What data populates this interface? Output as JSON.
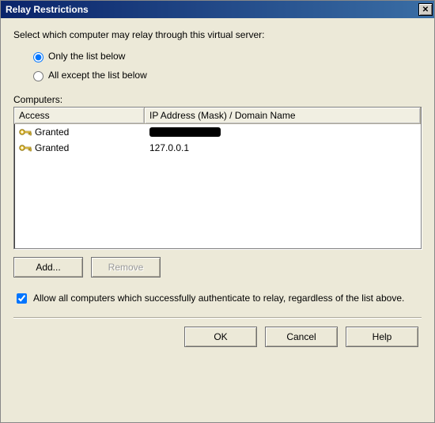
{
  "title": "Relay Restrictions",
  "instruction": "Select which computer may relay through this virtual server:",
  "radio": {
    "only_below": "Only the list below",
    "all_except": "All except the list below",
    "selected": "only_below"
  },
  "computers_label": "Computers:",
  "columns": {
    "access": "Access",
    "ip": "IP Address (Mask) / Domain Name"
  },
  "rows": [
    {
      "access": "Granted",
      "ip": "",
      "redacted": true
    },
    {
      "access": "Granted",
      "ip": "127.0.0.1",
      "redacted": false
    }
  ],
  "buttons": {
    "add": "Add...",
    "remove": "Remove"
  },
  "allow_auth_label": "Allow all computers which successfully authenticate to relay, regardless of the list above.",
  "allow_auth_checked": true,
  "footer": {
    "ok": "OK",
    "cancel": "Cancel",
    "help": "Help"
  }
}
